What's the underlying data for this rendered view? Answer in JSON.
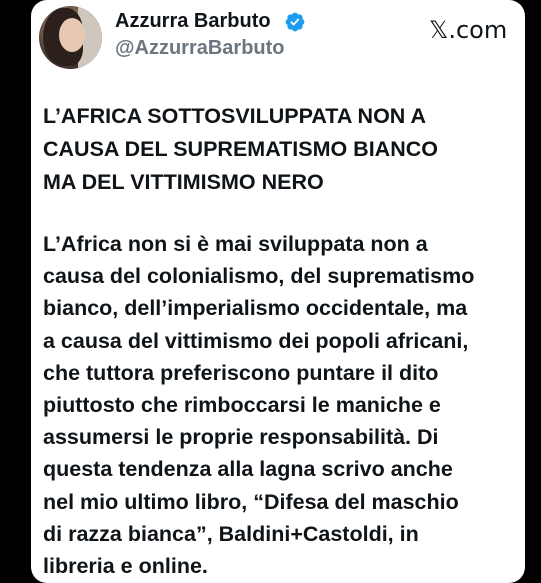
{
  "tweet": {
    "author_name": "Azzurra Barbuto",
    "author_handle": "@AzzurraBarbuto",
    "platform_label": "𝕏.com",
    "headline_lines": [
      "L’AFRICA SOTTOSVILUPPATA NON A",
      "CAUSA DEL SUPREMATISMO BIANCO",
      "MA DEL VITTIMISMO NERO"
    ],
    "body_lines": [
      "L’Africa non si è mai sviluppata non a",
      "causa del colonialismo, del suprematismo",
      "bianco, dell’imperialismo occidentale, ma",
      "a causa del vittimismo dei popoli africani,",
      "che tuttora preferiscono puntare il dito",
      "piuttosto che rimboccarsi le maniche e",
      "assumersi le proprie responsabilità. Di",
      "questa tendenza alla lagna scrivo anche",
      "nel mio ultimo libro, “Difesa del maschio",
      "di razza bianca”, Baldini+Castoldi, in",
      "libreria e online."
    ]
  },
  "colors": {
    "background": "#000000",
    "card": "#ffffff",
    "text": "#0f1419",
    "handle": "#6b7680",
    "verified": "#1d9bf0"
  },
  "icons": {
    "verified": "verified-badge-icon",
    "platform": "x-logo-icon"
  }
}
